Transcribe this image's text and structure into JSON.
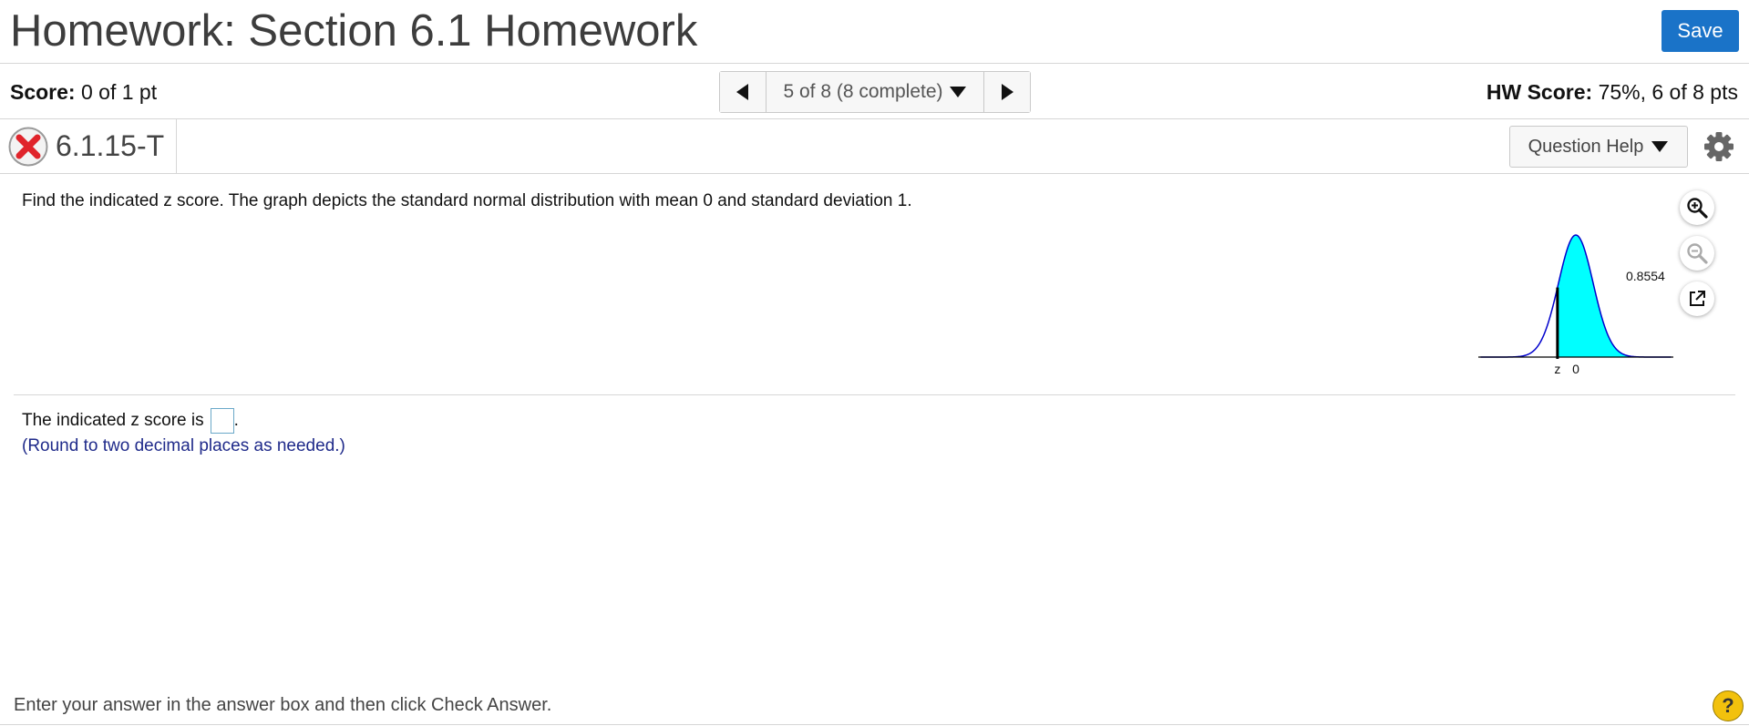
{
  "header": {
    "title": "Homework: Section 6.1 Homework",
    "save_label": "Save"
  },
  "score_bar": {
    "score_label": "Score:",
    "score_value": "0 of 1 pt",
    "nav_label": "5 of 8 (8 complete)",
    "hw_score_label": "HW Score:",
    "hw_score_value": "75%, 6 of 8 pts"
  },
  "question_header": {
    "status_icon": "incorrect-x-icon",
    "question_id": "6.1.15-T",
    "help_label": "Question Help",
    "settings_icon": "gear-icon"
  },
  "question": {
    "prompt": "Find the indicated z score. The graph depicts the standard normal distribution with mean 0 and standard deviation 1.",
    "graph": {
      "area_label": "0.8554",
      "z_label": "z",
      "mean_label": "0",
      "shaded_area": 0.8554,
      "fill_color": "#00ffff",
      "curve_color": "#0000cc"
    },
    "tools": [
      "zoom-in-icon",
      "zoom-out-icon",
      "open-external-icon"
    ]
  },
  "answer": {
    "prefix": "The indicated z score is",
    "suffix": ".",
    "value": "",
    "hint": "(Round to two decimal places as needed.)"
  },
  "footer": {
    "instruction": "Enter your answer in the answer box and then click Check Answer.",
    "help_label": "?"
  },
  "colors": {
    "primary": "#1a73c8",
    "hint_text": "#1f2a8a",
    "error": "#e0242b",
    "help_badge": "#f2c10d"
  }
}
